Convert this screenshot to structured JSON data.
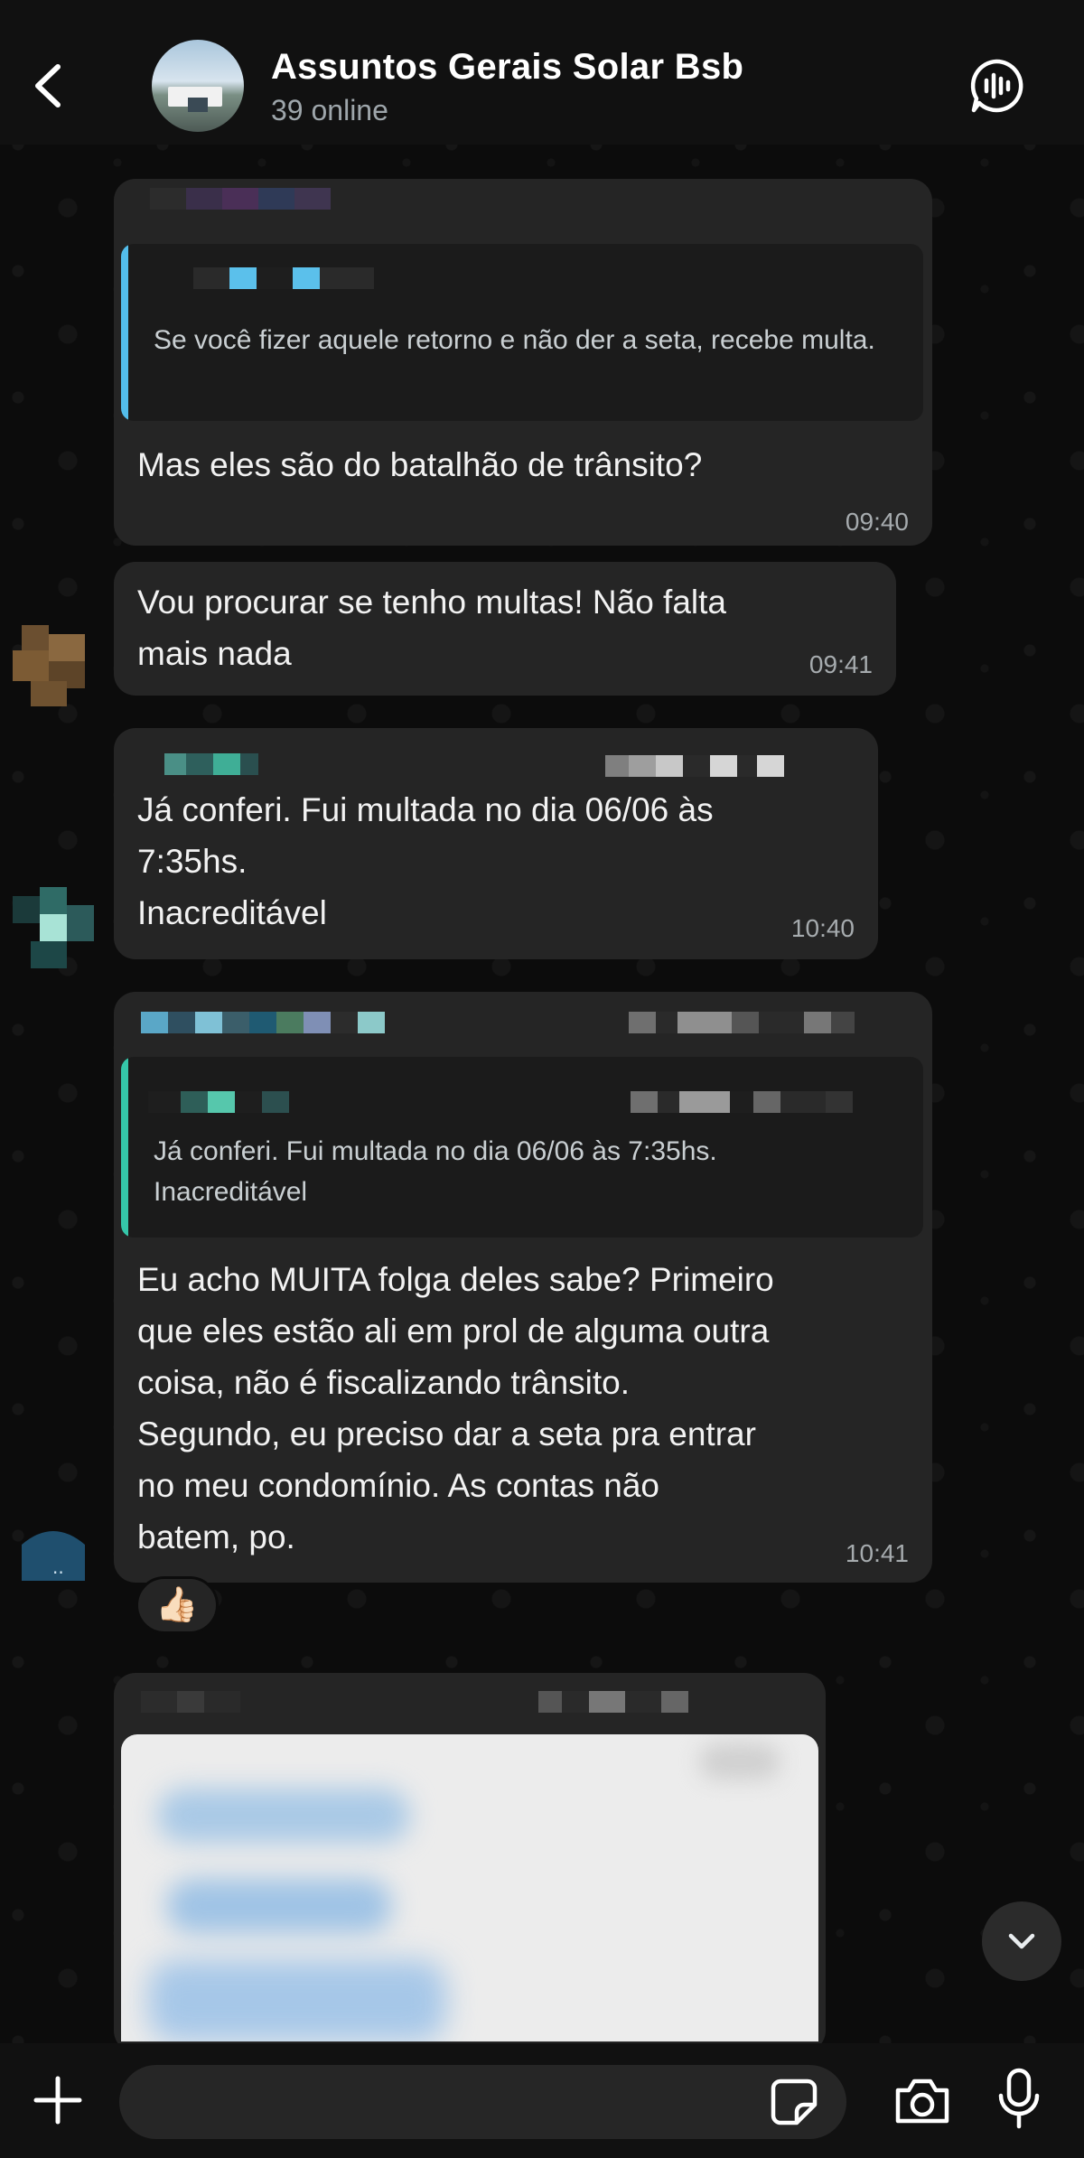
{
  "header": {
    "title": "Assuntos Gerais Solar Bsb",
    "subtitle": "39 online",
    "back_icon": "chevron-left-icon",
    "call_icon": "voice-chat-icon"
  },
  "messages": [
    {
      "quote_text": "Se você fizer aquele retorno e não der a seta, recebe multa.",
      "text": "Mas eles são do batalhão de trânsito?",
      "time": "09:40"
    },
    {
      "text": "Vou procurar se tenho multas! Não falta\nmais nada",
      "time": "09:41"
    },
    {
      "text": "Já conferi. Fui multada no dia 06/06 às\n7:35hs.\nInacreditável",
      "time": "10:40"
    },
    {
      "quote_text": "Já conferi. Fui multada no dia 06/06 às 7:35hs.\nInacreditável",
      "text": "Eu acho MUITA folga deles sabe? Primeiro\nque eles estão ali em prol de alguma outra\ncoisa, não é fiscalizando trânsito.\nSegundo, eu preciso dar a seta pra entrar\nno meu condomínio. As contas não\nbatem, po.",
      "time": "10:41",
      "reaction": "👍🏻"
    }
  ],
  "input": {
    "placeholder": ""
  },
  "colors": {
    "accent_quote_1": "#53bdeb",
    "accent_quote_2": "#35c6a9",
    "bubble": "#252525",
    "header": "#111111"
  }
}
